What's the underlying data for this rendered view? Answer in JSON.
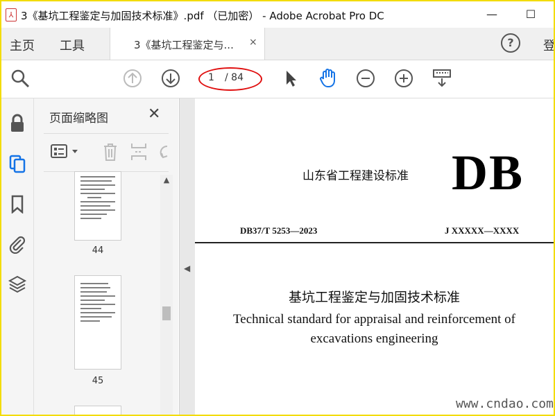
{
  "window": {
    "title": "3《基坑工程鉴定与加固技术标准》.pdf （已加密） - Adobe Acrobat Pro DC",
    "minimize": "—",
    "maximize": "☐"
  },
  "tabs": {
    "home": "主页",
    "tools": "工具",
    "document_tab": "3《基坑工程鉴定与...",
    "close": "×",
    "help": "?",
    "sign_in": "登"
  },
  "toolbar": {
    "current_page": "1",
    "total_pages": "/ 84",
    "icons": [
      "search-zoom-icon",
      "page-up-icon",
      "page-down-icon",
      "select-cursor-icon",
      "hand-tool-icon",
      "zoom-out-icon",
      "zoom-in-icon",
      "keyboard-scroll-icon"
    ]
  },
  "left_rail": {
    "icons": [
      "lock-icon",
      "pages-icon",
      "bookmark-icon",
      "attachment-icon",
      "layers-icon"
    ]
  },
  "thumbnail_panel": {
    "title": "页面缩略图",
    "close": "✕",
    "pages": [
      {
        "number": "44"
      },
      {
        "number": "45"
      }
    ]
  },
  "document": {
    "organization": "山东省工程建设标准",
    "badge": "DB",
    "standard_code": "DB37/T 5253—2023",
    "record_code": "J XXXXX—XXXX",
    "title_cn": "基坑工程鉴定与加固技术标准",
    "title_en_line1": "Technical standard for appraisal and reinforcement of",
    "title_en_line2": "excavations engineering",
    "watermark": "www.cndao.com"
  },
  "colors": {
    "accent_blue": "#1473e6",
    "highlight_red": "#e01010",
    "frame_yellow": "#f3dc00"
  }
}
